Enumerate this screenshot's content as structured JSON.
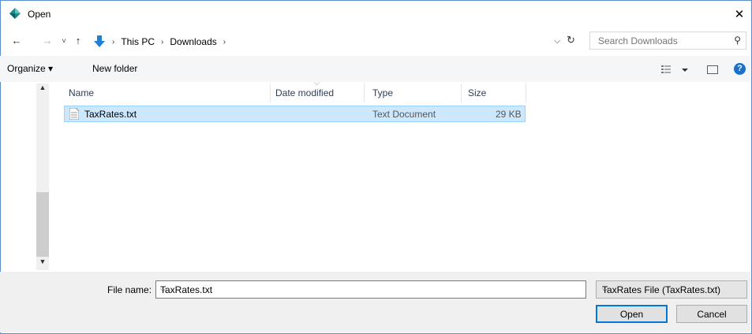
{
  "window": {
    "title": "Open"
  },
  "nav": {
    "back": "←",
    "forward": "→",
    "recent": "˅",
    "up": "↑",
    "breadcrumbs": [
      "This PC",
      "Downloads"
    ],
    "separator": "›"
  },
  "search": {
    "placeholder": "Search Downloads"
  },
  "toolbar": {
    "organize_label": "Organize ▾",
    "new_folder_label": "New folder"
  },
  "columns": {
    "name": "Name",
    "date_modified": "Date modified",
    "type": "Type",
    "size": "Size"
  },
  "files": [
    {
      "name": "TaxRates.txt",
      "date_modified": "",
      "type": "Text Document",
      "size": "29 KB"
    }
  ],
  "footer": {
    "file_name_label": "File name:",
    "file_name_value": "TaxRates.txt",
    "filter_value": "TaxRates File (TaxRates.txt)",
    "open_label": "Open",
    "cancel_label": "Cancel"
  },
  "colors": {
    "selection": "#cce8ff",
    "selection_border": "#99d1ff",
    "accent": "#0078d7"
  }
}
